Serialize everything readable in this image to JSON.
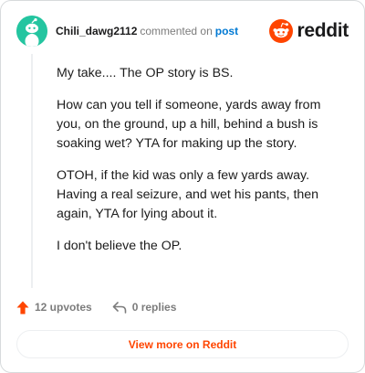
{
  "header": {
    "username": "Chili_dawg2112",
    "action_text": "commented on",
    "post_link": "post"
  },
  "logo": {
    "wordmark": "reddit",
    "icon": "reddit-snoo-icon"
  },
  "comment": {
    "paragraphs": [
      "My take.... The OP story is BS.",
      "How can you tell if someone, yards away from you, on the ground, up a hill, behind a bush is soaking wet? YTA for making up the story.",
      "OTOH, if the kid was only a few yards away. Having a real seizure, and wet his pants, then again, YTA for lying about it.",
      "I don't believe the OP."
    ]
  },
  "footer": {
    "upvotes_label": "12 upvotes",
    "replies_label": "0 replies",
    "upvote_icon": "upvote-arrow-icon",
    "reply_icon": "reply-arrow-icon"
  },
  "cta": {
    "label": "View more on Reddit"
  },
  "colors": {
    "accent": "#ff4500",
    "link": "#0079d3",
    "avatar": "#24c5a0",
    "muted": "#7c7c7c"
  }
}
